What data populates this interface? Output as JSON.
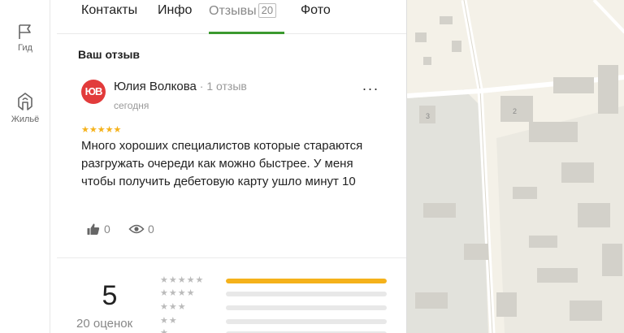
{
  "rail": {
    "items": [
      {
        "label": "Гид",
        "icon": "flag-icon"
      },
      {
        "label": "Жильё",
        "icon": "house-icon"
      }
    ]
  },
  "tabs": [
    {
      "label": "Контакты",
      "active": false
    },
    {
      "label": "Инфо",
      "active": false
    },
    {
      "label": "Отзывы",
      "count": "20",
      "active": true
    },
    {
      "label": "Фото",
      "active": false
    }
  ],
  "review_section": {
    "title": "Ваш отзыв",
    "avatar_initials": "ЮВ",
    "author": "Юлия Волкова",
    "author_meta": " · 1 отзыв",
    "date": "сегодня",
    "more": "···",
    "stars": "★★★★★",
    "rating": 5,
    "text": "Много хороших специалистов которые стараются разгружать очереди как можно быстрее. У меня чтобы получить дебетовую карту ушло минут 10",
    "likes": "0",
    "views": "0"
  },
  "summary": {
    "rating": "5",
    "count_label": "20 оценок",
    "distribution": [
      {
        "stars": "★★★★★",
        "fraction": 1.0
      },
      {
        "stars": "★★★★",
        "fraction": 0.0
      },
      {
        "stars": "★★★",
        "fraction": 0.0
      },
      {
        "stars": "★★",
        "fraction": 0.0
      },
      {
        "stars": "★",
        "fraction": 0.0
      }
    ]
  },
  "map": {
    "labels": [
      "3",
      "2"
    ]
  },
  "colors": {
    "accent_green": "#3b9a2f",
    "star_yellow": "#f5b21b",
    "avatar_red": "#e23b3b"
  }
}
